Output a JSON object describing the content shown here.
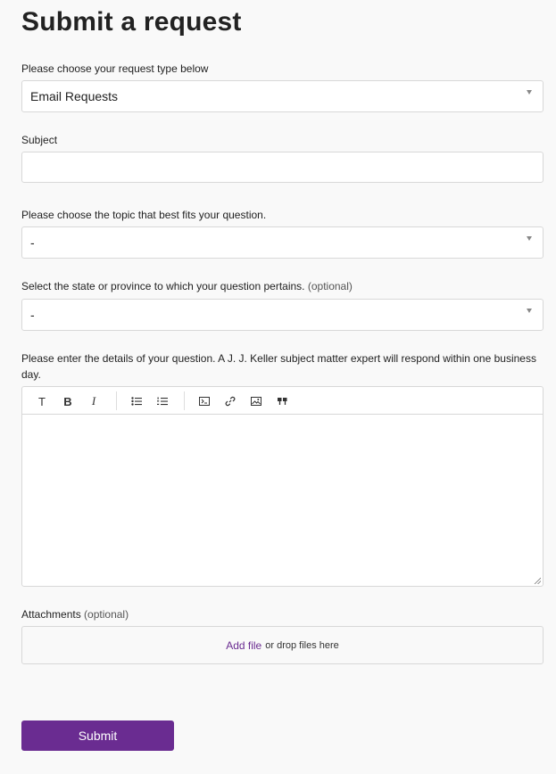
{
  "page": {
    "title": "Submit a request"
  },
  "request_type": {
    "label": "Please choose your request type below",
    "value": "Email Requests"
  },
  "subject": {
    "label": "Subject",
    "value": ""
  },
  "topic": {
    "label": "Please choose the topic that best fits your question.",
    "value": "-"
  },
  "state": {
    "label": "Select the state or province to which your question pertains.",
    "optional": "(optional)",
    "value": "-"
  },
  "details": {
    "label": "Please enter the details of your question. A J. J. Keller subject matter expert will respond within one business day.",
    "toolbar": {
      "text": "T",
      "bold": "B",
      "italic": "I"
    }
  },
  "attachments": {
    "label": "Attachments",
    "optional": "(optional)",
    "add_file": "Add file",
    "drop_text": "or drop files here"
  },
  "submit": {
    "label": "Submit"
  },
  "colors": {
    "accent": "#6a2c91",
    "border": "#d8d8d8",
    "background": "#f9f9f9"
  }
}
